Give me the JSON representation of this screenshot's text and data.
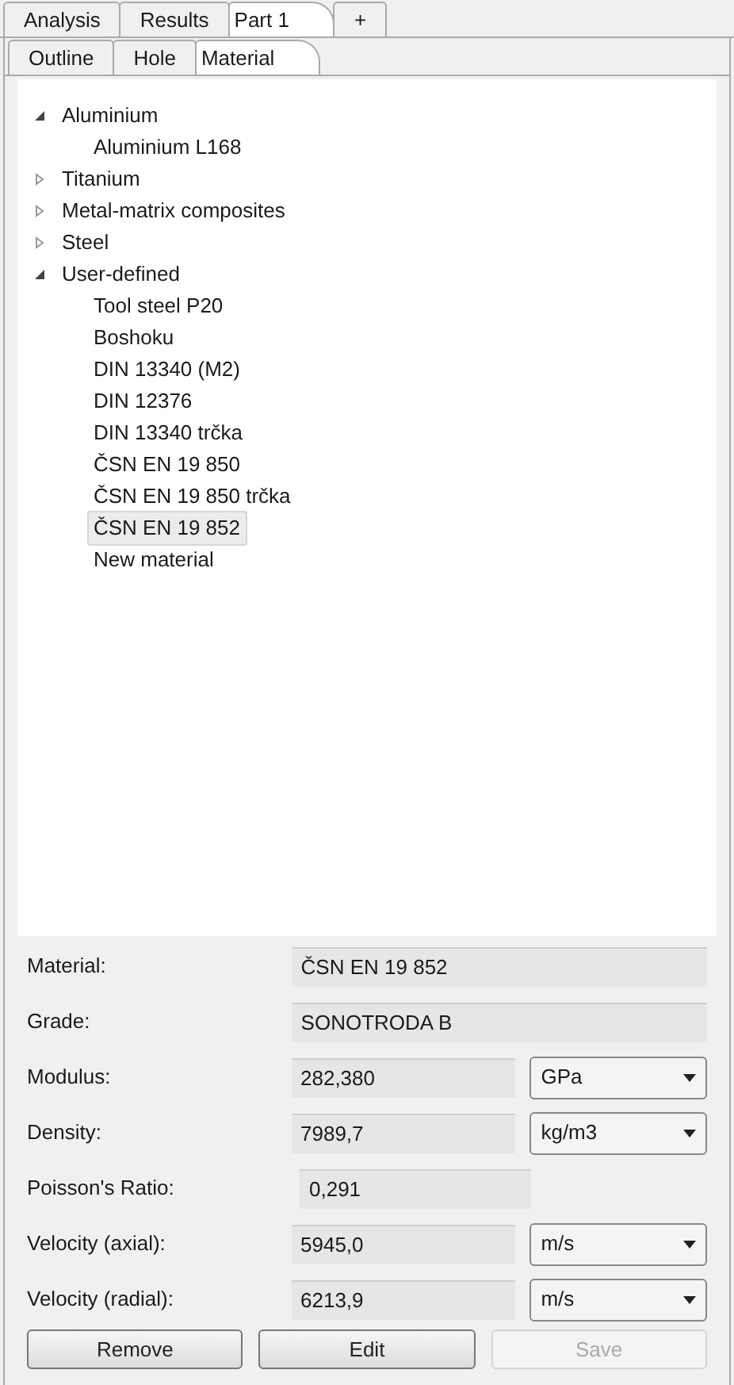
{
  "tabs": [
    {
      "label": "Analysis",
      "selected": false
    },
    {
      "label": "Results",
      "selected": false
    },
    {
      "label": "Part 1",
      "selected": true
    },
    {
      "label": "+",
      "selected": false
    }
  ],
  "subtabs": [
    {
      "label": "Outline",
      "selected": false
    },
    {
      "label": "Hole",
      "selected": false
    },
    {
      "label": "Material",
      "selected": true
    }
  ],
  "tree": [
    {
      "label": "Aluminium",
      "expanded": true,
      "selected": false,
      "children": [
        {
          "label": "Aluminium L168",
          "selected": false
        }
      ]
    },
    {
      "label": "Titanium",
      "expanded": false,
      "selected": false
    },
    {
      "label": "Metal-matrix composites",
      "expanded": false,
      "selected": false
    },
    {
      "label": "Steel",
      "expanded": false,
      "selected": false
    },
    {
      "label": "User-defined",
      "expanded": true,
      "selected": false,
      "children": [
        {
          "label": "Tool steel P20",
          "selected": false
        },
        {
          "label": "Boshoku",
          "selected": false
        },
        {
          "label": "DIN 13340 (M2)",
          "selected": false
        },
        {
          "label": "DIN 12376",
          "selected": false
        },
        {
          "label": "DIN 13340 trčka",
          "selected": false
        },
        {
          "label": "ČSN EN 19 850",
          "selected": false
        },
        {
          "label": "ČSN EN 19 850 trčka",
          "selected": false
        },
        {
          "label": "ČSN EN 19 852",
          "selected": true
        },
        {
          "label": "New material",
          "selected": false
        }
      ]
    }
  ],
  "fields": [
    {
      "label": "Material:",
      "value": "ČSN EN 19 852"
    },
    {
      "label": "Grade:",
      "value": "SONOTRODA B"
    },
    {
      "label": "Modulus:",
      "value": "282,380",
      "unit": "GPa"
    },
    {
      "label": "Density:",
      "value": "7989,7",
      "unit": "kg/m3"
    },
    {
      "label": "Poisson's Ratio:",
      "value": "0,291"
    },
    {
      "label": "Velocity (axial):",
      "value": "5945,0",
      "unit": "m/s"
    },
    {
      "label": "Velocity (radial):",
      "value": "6213,9",
      "unit": "m/s"
    }
  ],
  "buttons": [
    {
      "label": "Remove",
      "disabled": false
    },
    {
      "label": "Edit",
      "disabled": false
    },
    {
      "label": "Save",
      "disabled": true
    }
  ]
}
